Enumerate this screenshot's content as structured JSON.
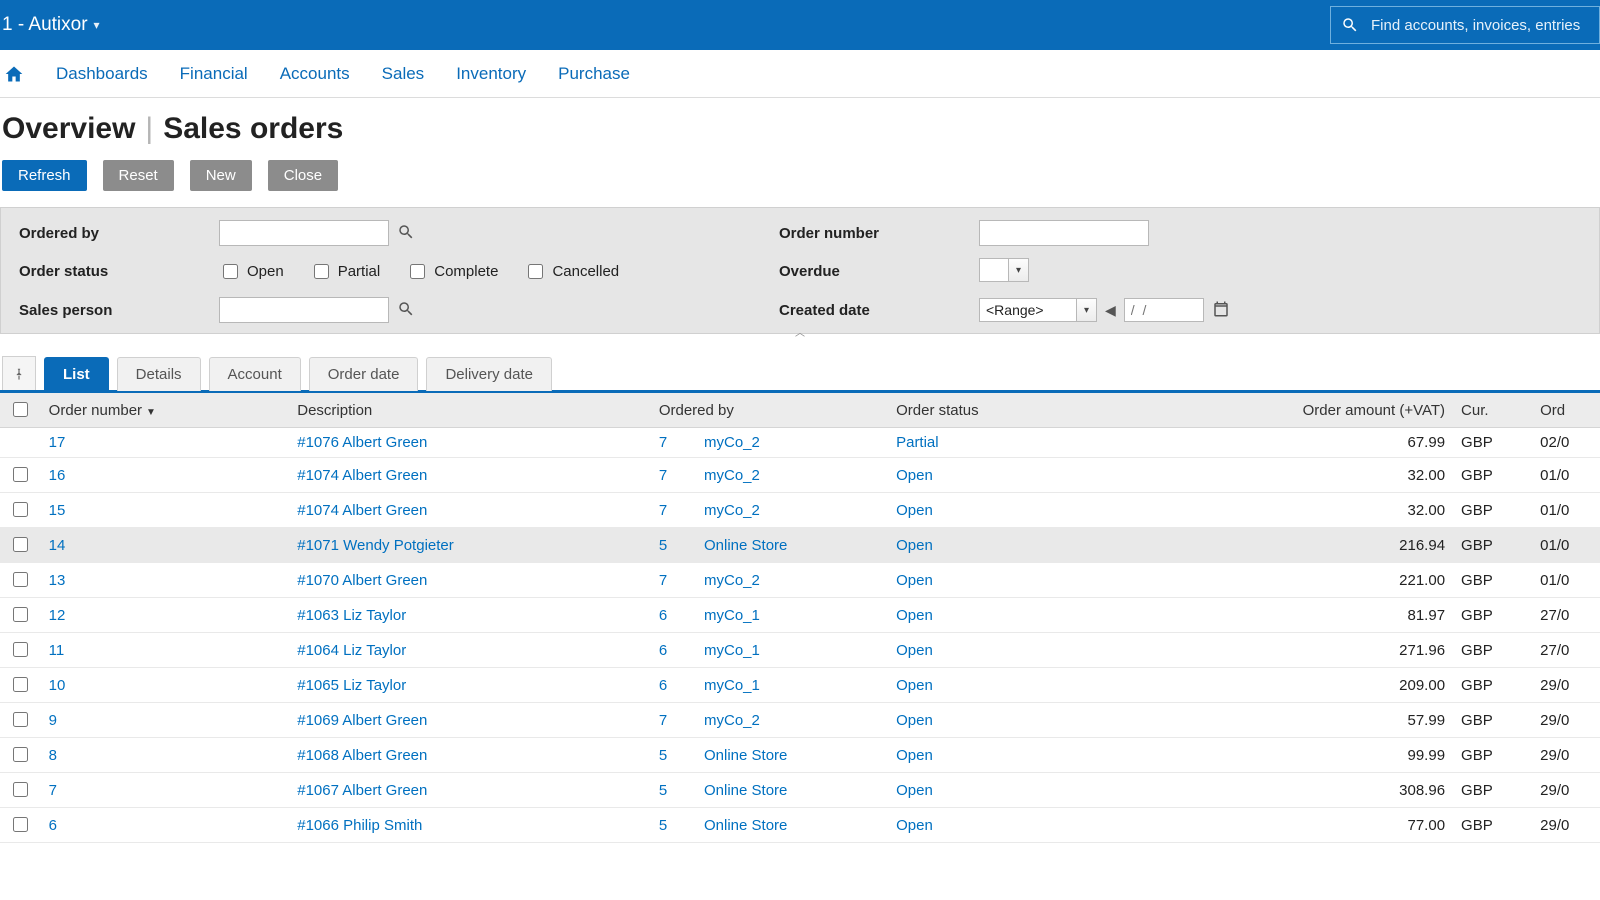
{
  "topbar": {
    "title": "1 - Autixor",
    "search_placeholder": "Find accounts, invoices, entries"
  },
  "nav": {
    "items": [
      "Dashboards",
      "Financial",
      "Accounts",
      "Sales",
      "Inventory",
      "Purchase"
    ]
  },
  "page": {
    "title_left": "Overview",
    "title_right": "Sales orders"
  },
  "actions": {
    "refresh": "Refresh",
    "reset": "Reset",
    "new": "New",
    "close": "Close"
  },
  "filters": {
    "ordered_by_label": "Ordered by",
    "order_status_label": "Order status",
    "sales_person_label": "Sales person",
    "order_number_label": "Order number",
    "overdue_label": "Overdue",
    "created_date_label": "Created date",
    "status_options": [
      "Open",
      "Partial",
      "Complete",
      "Cancelled"
    ],
    "range_text": "<Range>",
    "date_placeholder": "/  /"
  },
  "tabs": {
    "items": [
      "List",
      "Details",
      "Account",
      "Order date",
      "Delivery date"
    ],
    "active": "List"
  },
  "grid": {
    "headers": {
      "order_number": "Order number",
      "description": "Description",
      "ordered_by": "Ordered by",
      "order_status": "Order status",
      "order_amount": "Order amount (+VAT)",
      "currency": "Cur.",
      "order_date": "Ord"
    },
    "rows": [
      {
        "no_checkbox": true,
        "order_number": "17",
        "description": "#1076 Albert Green",
        "ordered_by_num": "7",
        "ordered_by": "myCo_2",
        "status": "Partial",
        "amount": "67.99",
        "currency": "GBP",
        "date": "02/0"
      },
      {
        "order_number": "16",
        "description": "#1074 Albert Green",
        "ordered_by_num": "7",
        "ordered_by": "myCo_2",
        "status": "Open",
        "amount": "32.00",
        "currency": "GBP",
        "date": "01/0"
      },
      {
        "order_number": "15",
        "description": "#1074 Albert Green",
        "ordered_by_num": "7",
        "ordered_by": "myCo_2",
        "status": "Open",
        "amount": "32.00",
        "currency": "GBP",
        "date": "01/0"
      },
      {
        "hover": true,
        "order_number": "14",
        "description": "#1071 Wendy Potgieter",
        "ordered_by_num": "5",
        "ordered_by": "Online Store",
        "status": "Open",
        "amount": "216.94",
        "currency": "GBP",
        "date": "01/0"
      },
      {
        "order_number": "13",
        "description": "#1070 Albert Green",
        "ordered_by_num": "7",
        "ordered_by": "myCo_2",
        "status": "Open",
        "amount": "221.00",
        "currency": "GBP",
        "date": "01/0"
      },
      {
        "order_number": "12",
        "description": "#1063 Liz Taylor",
        "ordered_by_num": "6",
        "ordered_by": "myCo_1",
        "status": "Open",
        "amount": "81.97",
        "currency": "GBP",
        "date": "27/0"
      },
      {
        "order_number": "11",
        "description": "#1064 Liz Taylor",
        "ordered_by_num": "6",
        "ordered_by": "myCo_1",
        "status": "Open",
        "amount": "271.96",
        "currency": "GBP",
        "date": "27/0"
      },
      {
        "order_number": "10",
        "description": "#1065 Liz Taylor",
        "ordered_by_num": "6",
        "ordered_by": "myCo_1",
        "status": "Open",
        "amount": "209.00",
        "currency": "GBP",
        "date": "29/0"
      },
      {
        "order_number": "9",
        "description": "#1069 Albert Green",
        "ordered_by_num": "7",
        "ordered_by": "myCo_2",
        "status": "Open",
        "amount": "57.99",
        "currency": "GBP",
        "date": "29/0"
      },
      {
        "order_number": "8",
        "description": "#1068 Albert Green",
        "ordered_by_num": "5",
        "ordered_by": "Online Store",
        "status": "Open",
        "amount": "99.99",
        "currency": "GBP",
        "date": "29/0"
      },
      {
        "order_number": "7",
        "description": "#1067 Albert Green",
        "ordered_by_num": "5",
        "ordered_by": "Online Store",
        "status": "Open",
        "amount": "308.96",
        "currency": "GBP",
        "date": "29/0"
      },
      {
        "order_number": "6",
        "description": "#1066 Philip Smith",
        "ordered_by_num": "5",
        "ordered_by": "Online Store",
        "status": "Open",
        "amount": "77.00",
        "currency": "GBP",
        "date": "29/0"
      }
    ]
  }
}
